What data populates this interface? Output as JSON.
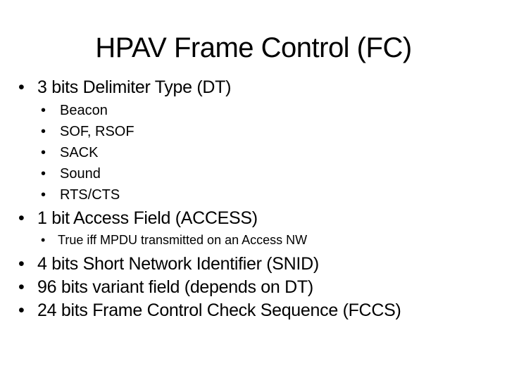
{
  "slide": {
    "title": "HPAV Frame Control (FC)",
    "bullet_glyph": "•",
    "items": [
      {
        "text": "3 bits Delimiter Type (DT)",
        "children": [
          "Beacon",
          "SOF, RSOF",
          "SACK",
          "Sound",
          "RTS/CTS"
        ]
      },
      {
        "text": "1 bit Access Field (ACCESS)",
        "children": [
          "True iff MPDU transmitted on an Access NW"
        ]
      },
      {
        "text": "4 bits Short Network Identifier (SNID)"
      },
      {
        "text": "96 bits variant field (depends on DT)"
      },
      {
        "text": "24 bits Frame Control Check Sequence (FCCS)"
      }
    ]
  }
}
